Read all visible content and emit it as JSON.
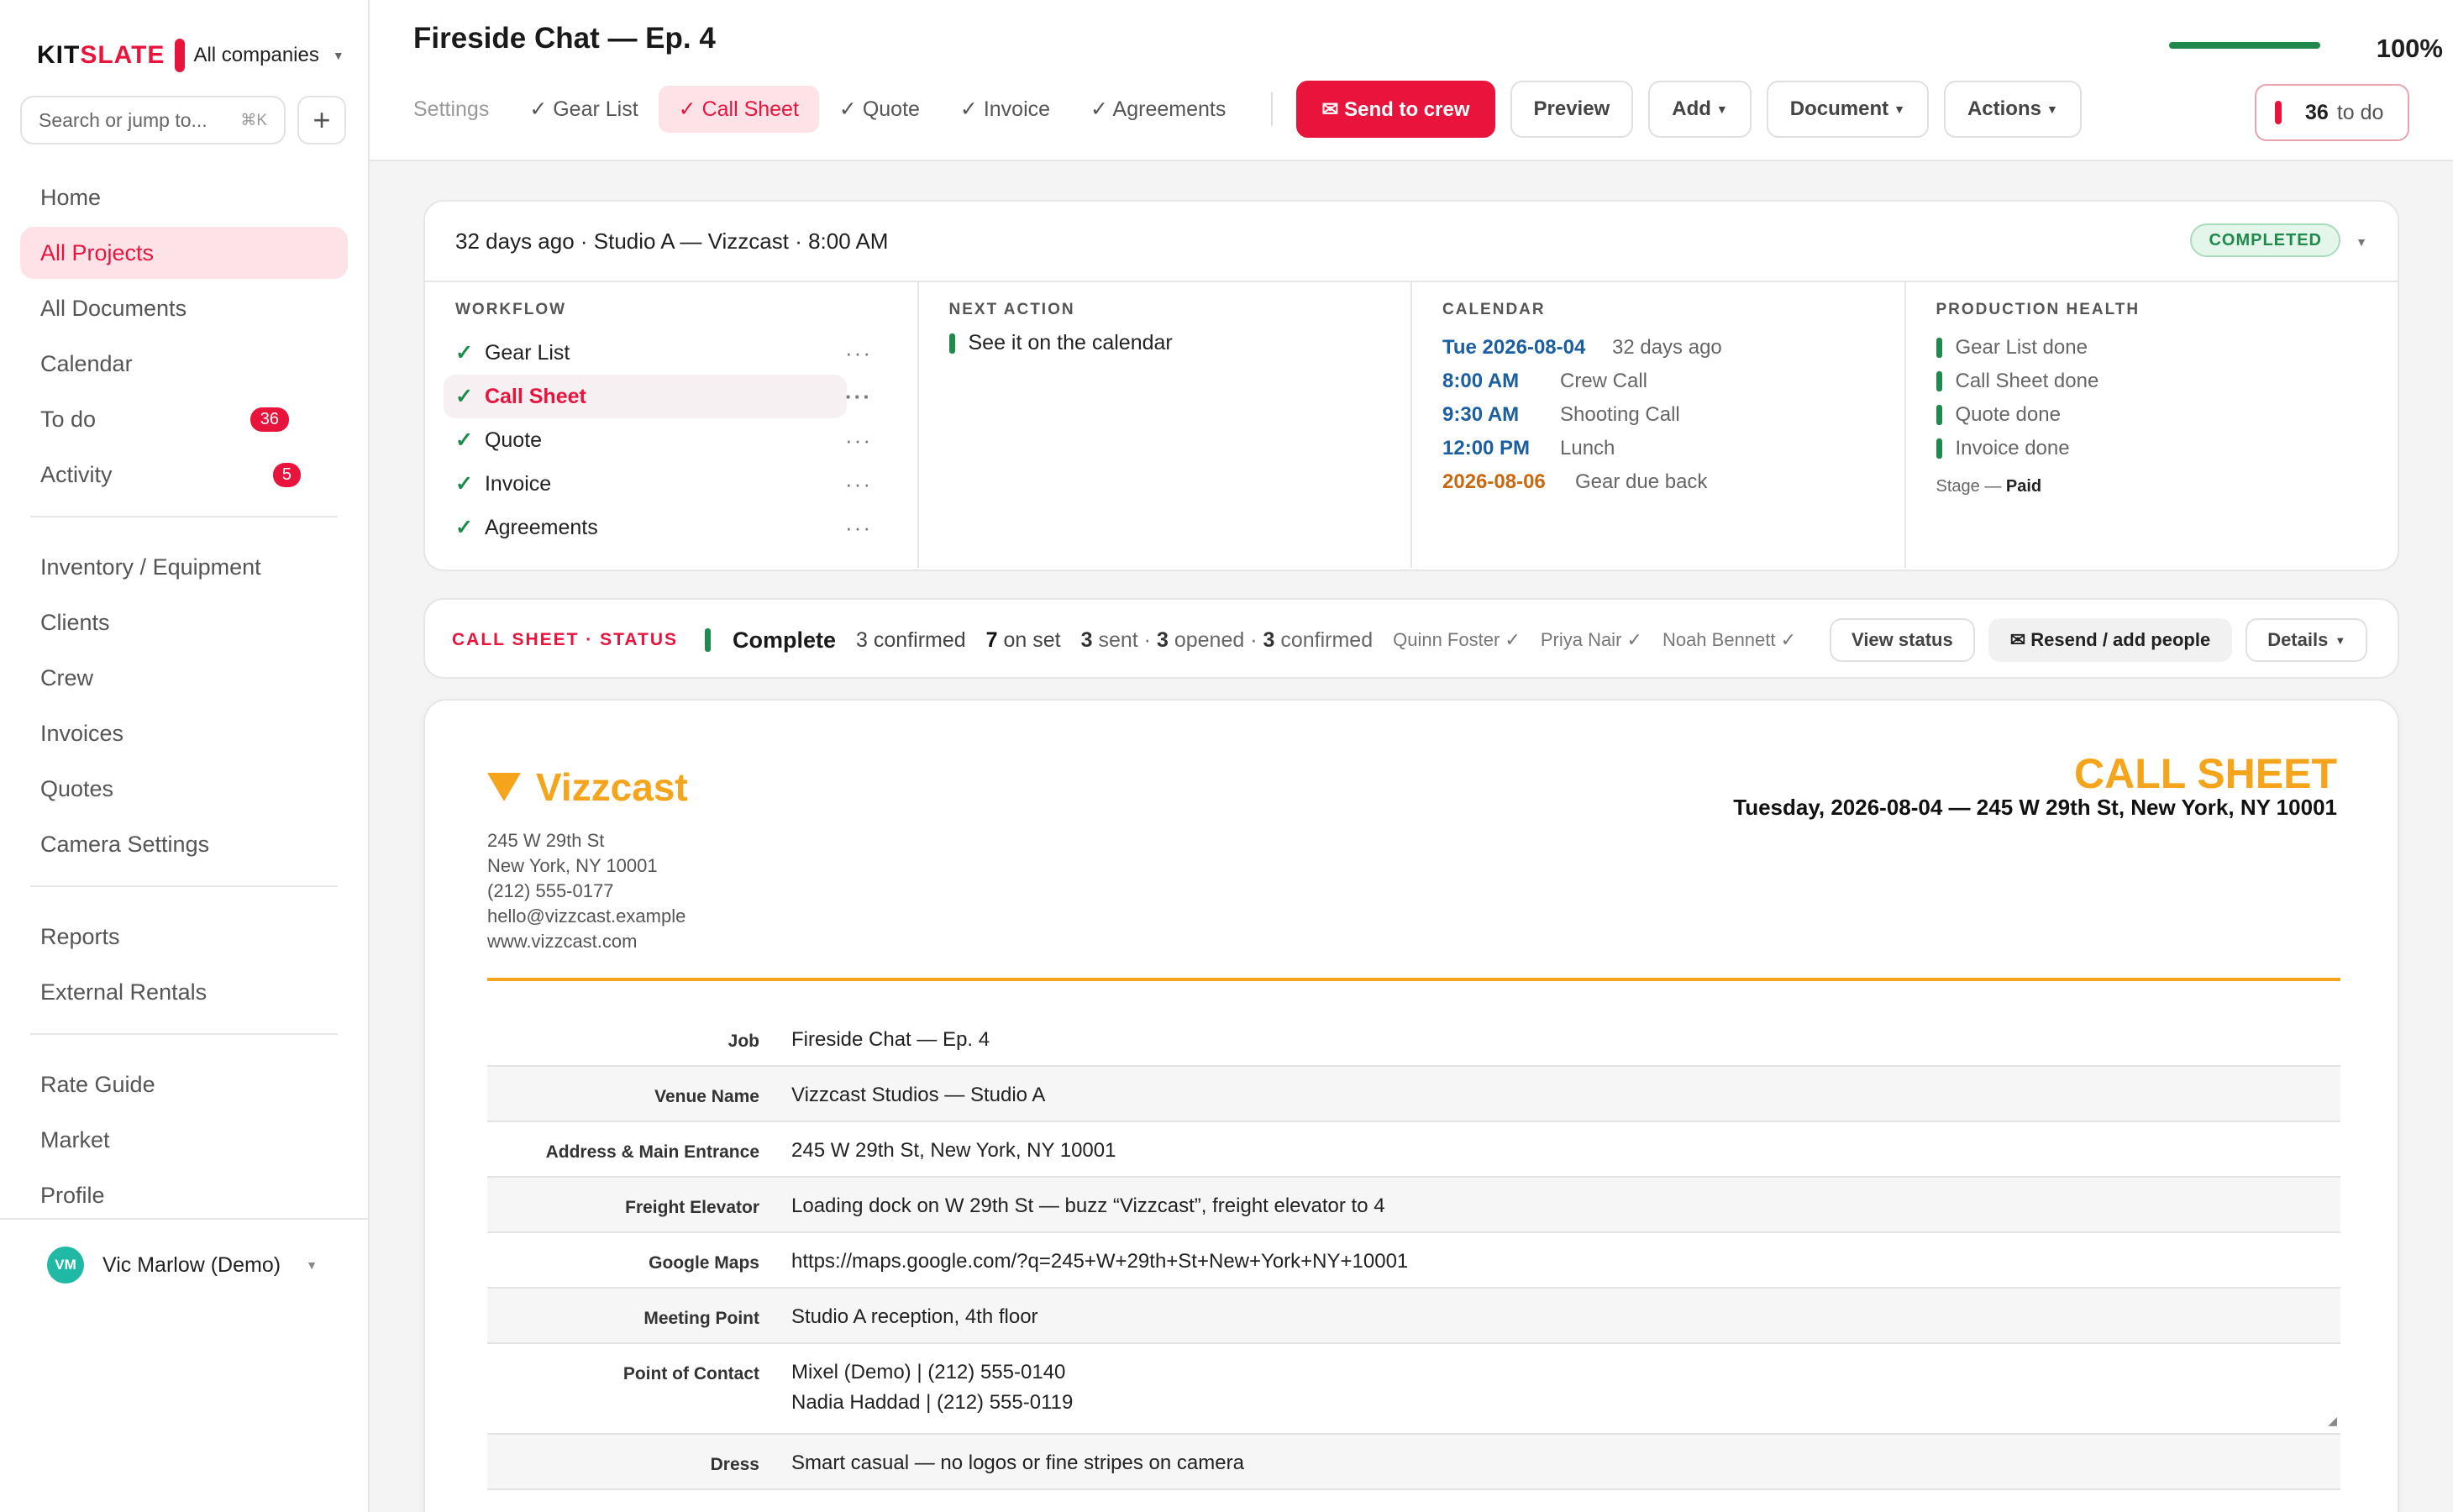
{
  "sidebar": {
    "brand": {
      "logo_a": "KIT",
      "logo_b": "SLATE",
      "company": "All companies"
    },
    "search_placeholder": "Search or jump to...",
    "search_shortcut": "⌘K",
    "add_label": "+",
    "group1": [
      {
        "label": "Home"
      },
      {
        "label": "All Projects"
      },
      {
        "label": "All Documents"
      },
      {
        "label": "Calendar"
      },
      {
        "label": "To do",
        "badge": "36"
      },
      {
        "label": "Activity",
        "badge": "5"
      }
    ],
    "group2": [
      {
        "label": "Inventory / Equipment"
      },
      {
        "label": "Clients"
      },
      {
        "label": "Crew"
      },
      {
        "label": "Invoices"
      },
      {
        "label": "Quotes"
      },
      {
        "label": "Camera Settings"
      }
    ],
    "group3": [
      {
        "label": "Reports"
      },
      {
        "label": "External Rentals"
      }
    ],
    "group4": [
      {
        "label": "Rate Guide"
      },
      {
        "label": "Market"
      },
      {
        "label": "Profile"
      }
    ],
    "user": {
      "initials": "VM",
      "name": "Vic Marlow (Demo)"
    }
  },
  "header": {
    "title": "Fireside Chat — Ep. 4",
    "progress": {
      "value": 1.0,
      "label": "100%"
    },
    "tabs": [
      {
        "label": "Settings"
      },
      {
        "label": "✓ Gear List"
      },
      {
        "label": "✓ Call Sheet"
      },
      {
        "label": "✓ Quote"
      },
      {
        "label": "✓ Invoice"
      },
      {
        "label": "✓ Agreements"
      }
    ],
    "send_label": "✉ Send to crew",
    "preview_label": "Preview",
    "add_label": "Add",
    "document_label": "Document",
    "actions_label": "Actions",
    "todo": {
      "count": "36",
      "label": "to do"
    }
  },
  "overview": {
    "summary": "32 days ago · Studio A — Vizzcast · 8:00 AM",
    "status_badge": "COMPLETED",
    "workflow": {
      "heading": "WORKFLOW",
      "items": [
        "Gear List",
        "Call Sheet",
        "Quote",
        "Invoice",
        "Agreements"
      ]
    },
    "next_action": {
      "heading": "NEXT ACTION",
      "item": "See it on the calendar"
    },
    "calendar": {
      "heading": "CALENDAR",
      "rows": [
        {
          "k": "Tue 2026-08-04",
          "v": "32 days ago"
        },
        {
          "k": "8:00 AM",
          "v": "Crew Call"
        },
        {
          "k": "9:30 AM",
          "v": "Shooting Call"
        },
        {
          "k": "12:00 PM",
          "v": "Lunch"
        },
        {
          "k": "2026-08-06",
          "v": "Gear due back"
        }
      ]
    },
    "health": {
      "heading": "PRODUCTION HEALTH",
      "items": [
        "Gear List done",
        "Call Sheet done",
        "Quote done",
        "Invoice done"
      ],
      "stage_label": "Stage —",
      "stage_value": "Paid"
    }
  },
  "status_bar": {
    "label": "CALL SHEET · STATUS",
    "state": "Complete",
    "confirmed_n": "3",
    "confirmed_t": "confirmed",
    "onset_n": "7",
    "onset_t": "on set",
    "sent_n": "3",
    "sent_t": "sent ·",
    "opened_n": "3",
    "opened_t": "opened ·",
    "conf2_n": "3",
    "conf2_t": "confirmed",
    "people": [
      "Quinn Foster ✓",
      "Priya Nair ✓",
      "Noah Bennett ✓"
    ],
    "view_status_label": "View status",
    "resend_label": "✉ Resend / add people",
    "details_label": "Details"
  },
  "document": {
    "company": "Vizzcast",
    "address_lines": [
      "245 W 29th St",
      "New York, NY 10001",
      "(212) 555-0177",
      "hello@vizzcast.example",
      "www.vizzcast.com"
    ],
    "title": "CALL SHEET",
    "subtitle": "Tuesday, 2026-08-04 — 245 W 29th St, New York, NY 10001",
    "fields": [
      {
        "k": "Job",
        "v": "Fireside Chat — Ep. 4"
      },
      {
        "k": "Venue Name",
        "v": "Vizzcast Studios — Studio A"
      },
      {
        "k": "Address & Main Entrance",
        "v": "245 W 29th St, New York, NY 10001"
      },
      {
        "k": "Freight Elevator",
        "v": "Loading dock on W 29th St — buzz “Vizzcast”, freight elevator to 4"
      },
      {
        "k": "Google Maps",
        "v": "https://maps.google.com/?q=245+W+29th+St+New+York+NY+10001"
      },
      {
        "k": "Meeting Point",
        "v": "Studio A reception, 4th floor"
      },
      {
        "k": "Point of Contact",
        "v1": "Mixel (Demo) | (212) 555-0140",
        "v2": "Nadia Haddad | (212) 555-0119"
      },
      {
        "k": "Dress",
        "v": "Smart casual — no logos or fine stripes on camera"
      }
    ]
  },
  "colors": {
    "accent": "#e8143c",
    "success": "#1f8a4c",
    "brand_doc": "#f4a51c",
    "calendar": "#1b5fa0"
  }
}
